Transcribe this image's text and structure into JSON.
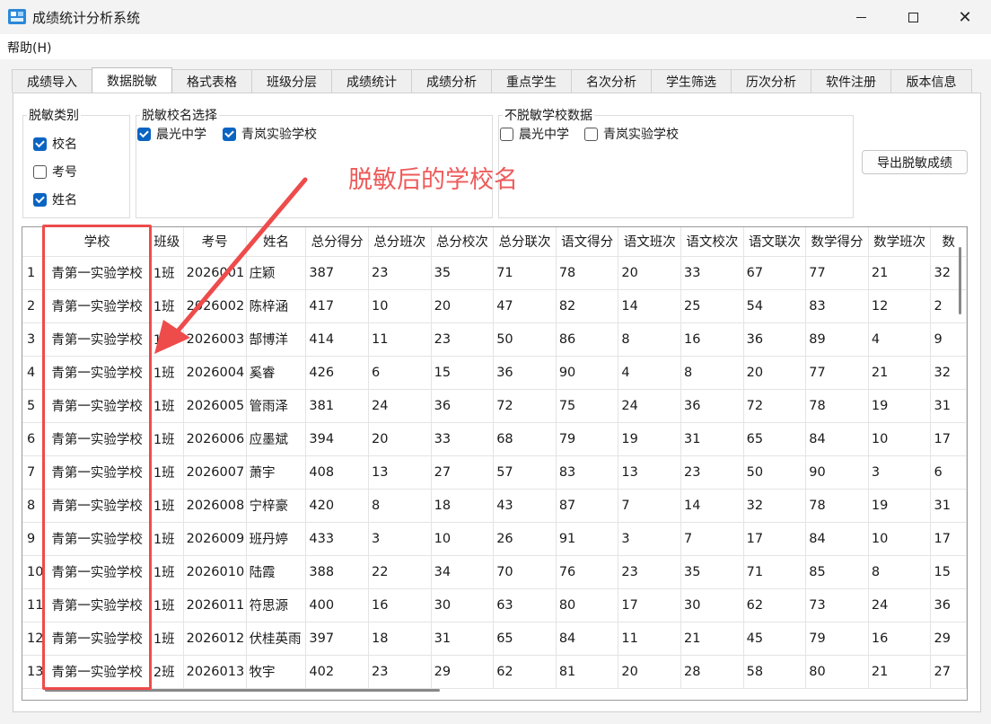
{
  "window": {
    "title": "成绩统计分析系统"
  },
  "menu": {
    "help": "帮助(H)"
  },
  "tabs": [
    {
      "label": "成绩导入",
      "width": 90
    },
    {
      "label": "数据脱敏",
      "width": 90,
      "active": true
    },
    {
      "label": "格式表格",
      "width": 90
    },
    {
      "label": "班级分层",
      "width": 90
    },
    {
      "label": "成绩统计",
      "width": 90
    },
    {
      "label": "成绩分析",
      "width": 90
    },
    {
      "label": "重点学生",
      "width": 90
    },
    {
      "label": "名次分析",
      "width": 90
    },
    {
      "label": "学生筛选",
      "width": 90
    },
    {
      "label": "历次分析",
      "width": 90
    },
    {
      "label": "软件注册",
      "width": 90
    },
    {
      "label": "版本信息",
      "width": 91
    }
  ],
  "desensitize_type": {
    "legend": "脱敏类别",
    "options": [
      {
        "label": "校名",
        "checked": true
      },
      {
        "label": "考号",
        "checked": false
      },
      {
        "label": "姓名",
        "checked": true
      }
    ]
  },
  "school_select": {
    "legend": "脱敏校名选择",
    "options": [
      {
        "label": "晨光中学",
        "checked": true
      },
      {
        "label": "青岚实验学校",
        "checked": true
      }
    ]
  },
  "keep_school": {
    "legend": "不脱敏学校数据",
    "options": [
      {
        "label": "晨光中学",
        "checked": false
      },
      {
        "label": "青岚实验学校",
        "checked": false
      }
    ]
  },
  "export_button": "导出脱敏成绩",
  "annotation": {
    "text": "脱敏后的学校名",
    "color": "#ee5a5a"
  },
  "table": {
    "columns": [
      "学校",
      "班级",
      "考号",
      "姓名",
      "总分得分",
      "总分班次",
      "总分校次",
      "总分联次",
      "语文得分",
      "语文班次",
      "语文校次",
      "语文联次",
      "数学得分",
      "数学班次",
      "数"
    ],
    "rows": [
      [
        "1",
        "青第一实验学校",
        "1班",
        "2026001",
        "庄颖",
        "387",
        "23",
        "35",
        "71",
        "78",
        "20",
        "33",
        "67",
        "77",
        "21",
        "32"
      ],
      [
        "2",
        "青第一实验学校",
        "1班",
        "2026002",
        "陈梓涵",
        "417",
        "10",
        "20",
        "47",
        "82",
        "14",
        "25",
        "54",
        "83",
        "12",
        "2"
      ],
      [
        "3",
        "青第一实验学校",
        "1班",
        "2026003",
        "郜博洋",
        "414",
        "11",
        "23",
        "50",
        "86",
        "8",
        "16",
        "36",
        "89",
        "4",
        "9"
      ],
      [
        "4",
        "青第一实验学校",
        "1班",
        "2026004",
        "奚睿",
        "426",
        "6",
        "15",
        "36",
        "90",
        "4",
        "8",
        "20",
        "77",
        "21",
        "32"
      ],
      [
        "5",
        "青第一实验学校",
        "1班",
        "2026005",
        "管雨泽",
        "381",
        "24",
        "36",
        "72",
        "75",
        "24",
        "36",
        "72",
        "78",
        "19",
        "31"
      ],
      [
        "6",
        "青第一实验学校",
        "1班",
        "2026006",
        "应墨斌",
        "394",
        "20",
        "33",
        "68",
        "79",
        "19",
        "31",
        "65",
        "84",
        "10",
        "17"
      ],
      [
        "7",
        "青第一实验学校",
        "1班",
        "2026007",
        "萧宇",
        "408",
        "13",
        "27",
        "57",
        "83",
        "13",
        "23",
        "50",
        "90",
        "3",
        "6"
      ],
      [
        "8",
        "青第一实验学校",
        "1班",
        "2026008",
        "宁梓豪",
        "420",
        "8",
        "18",
        "43",
        "87",
        "7",
        "14",
        "32",
        "78",
        "19",
        "31"
      ],
      [
        "9",
        "青第一实验学校",
        "1班",
        "2026009",
        "班丹婷",
        "433",
        "3",
        "10",
        "26",
        "91",
        "3",
        "7",
        "17",
        "84",
        "10",
        "17"
      ],
      [
        "10",
        "青第一实验学校",
        "1班",
        "2026010",
        "陆霞",
        "388",
        "22",
        "34",
        "70",
        "76",
        "23",
        "35",
        "71",
        "85",
        "8",
        "15"
      ],
      [
        "11",
        "青第一实验学校",
        "1班",
        "2026011",
        "符思源",
        "400",
        "16",
        "30",
        "63",
        "80",
        "17",
        "30",
        "62",
        "73",
        "24",
        "36"
      ],
      [
        "12",
        "青第一实验学校",
        "1班",
        "2026012",
        "伏桂英雨",
        "397",
        "18",
        "31",
        "65",
        "84",
        "11",
        "21",
        "45",
        "79",
        "16",
        "29"
      ],
      [
        "13",
        "青第一实验学校",
        "2班",
        "2026013",
        "牧宇",
        "402",
        "23",
        "29",
        "62",
        "81",
        "20",
        "28",
        "58",
        "80",
        "21",
        "27"
      ]
    ]
  }
}
